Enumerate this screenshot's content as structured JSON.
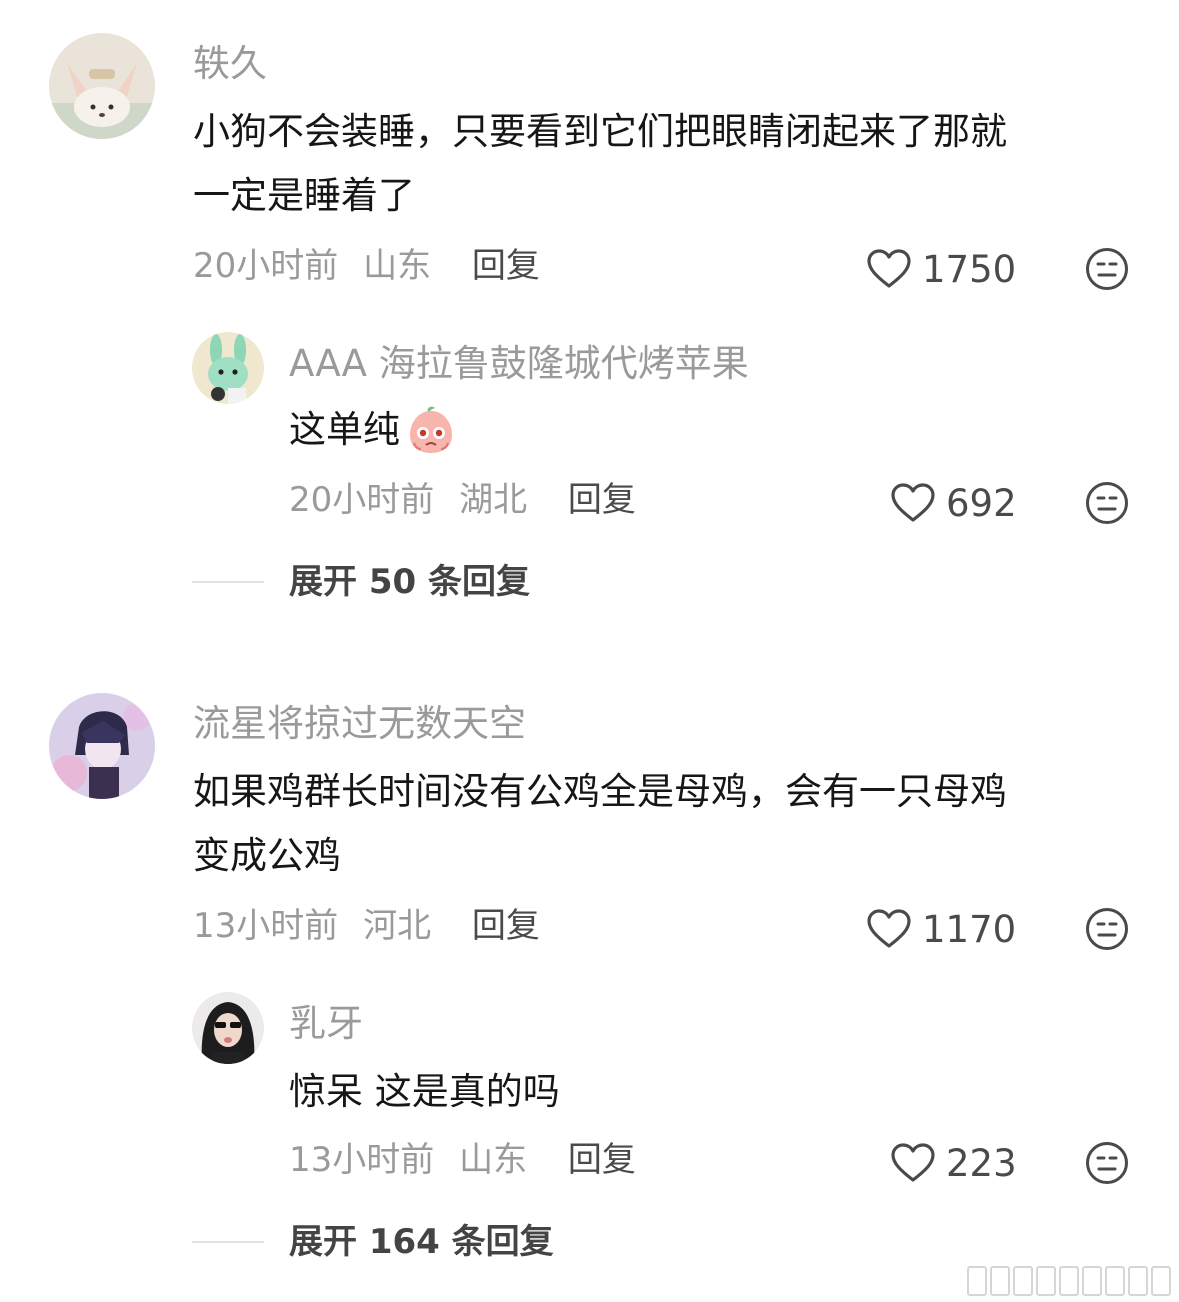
{
  "comments": [
    {
      "username": "轶久",
      "text_lines": [
        "小狗不会装睡，只要看到它们把眼睛闭起来了那就",
        "一定是睡着了"
      ],
      "time": "20小时前",
      "location": "山东",
      "reply_label": "回复",
      "likes": "1750",
      "avatar": "fennec-fox-avatar"
    },
    {
      "username": "AAA 海拉鲁鼓隆城代烤苹果",
      "text": "这单纯",
      "emoji": "crying-peach-emoji",
      "time": "20小时前",
      "location": "湖北",
      "reply_label": "回复",
      "likes": "692",
      "avatar": "green-bunny-avatar"
    },
    {
      "username": "流星将掠过无数天空",
      "text_lines": [
        "如果鸡群长时间没有公鸡全是母鸡，会有一只母鸡",
        "变成公鸡"
      ],
      "time": "13小时前",
      "location": "河北",
      "reply_label": "回复",
      "likes": "1170",
      "avatar": "anime-boy-avatar"
    },
    {
      "username": "乳牙",
      "text": "惊呆 这是真的吗",
      "time": "13小时前",
      "location": "山东",
      "reply_label": "回复",
      "likes": "223",
      "avatar": "girl-sunglasses-avatar"
    }
  ],
  "expand": [
    "展开 50 条回复",
    "展开 164 条回复"
  ],
  "colors": {
    "username": "#9a9a9a",
    "text": "#161616",
    "meta": "#9a9a9a",
    "action": "#4a4a4a"
  },
  "icons": [
    "heart-outline-icon",
    "neutral-face-icon"
  ]
}
